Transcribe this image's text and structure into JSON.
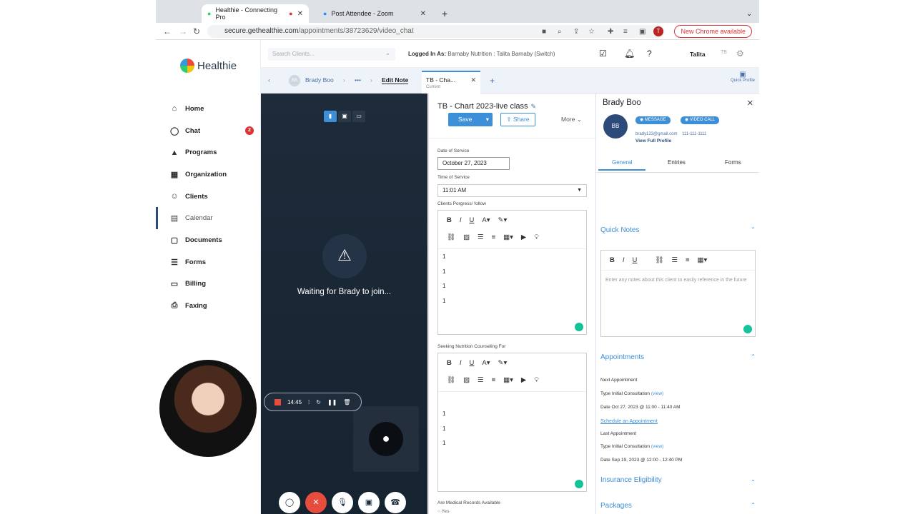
{
  "browser": {
    "tabs": [
      {
        "label": "Healthie - Connecting Pro"
      },
      {
        "label": "Post Attendee - Zoom"
      }
    ],
    "url_domain": "secure.gethealthie.com",
    "url_path": "/appointments/38723629/video_chat",
    "new_chrome_label": "New Chrome available",
    "profile_initial": "T"
  },
  "app": {
    "logo_text": "Healthie",
    "search_placeholder": "Search Clients...",
    "logged_in_label": "Logged In As:",
    "logged_in_value": "Barnaby Nutrition : Talita Barnaby (Switch)",
    "user_name": "Talita",
    "user_initials": "TB"
  },
  "sidebar": {
    "items": [
      {
        "label": "Home",
        "icon": "home-icon"
      },
      {
        "label": "Chat",
        "icon": "chat-icon",
        "badge": "2"
      },
      {
        "label": "Programs",
        "icon": "programs-icon"
      },
      {
        "label": "Organization",
        "icon": "organization-icon"
      },
      {
        "label": "Clients",
        "icon": "clients-icon"
      },
      {
        "label": "Calendar",
        "icon": "calendar-icon"
      },
      {
        "label": "Documents",
        "icon": "documents-icon"
      },
      {
        "label": "Forms",
        "icon": "forms-icon"
      },
      {
        "label": "Billing",
        "icon": "billing-icon"
      },
      {
        "label": "Faxing",
        "icon": "faxing-icon"
      }
    ]
  },
  "subbar": {
    "client_initials": "BB",
    "client_name": "Brady Boo",
    "dots": "•••",
    "edit_note": "Edit Note",
    "note_tab_title": "TB - Cha...",
    "note_tab_sub": "Current",
    "quick_profile": "Quick Profile"
  },
  "video": {
    "waiting": "Waiting for Brady to join...",
    "timer": "14:45"
  },
  "note": {
    "title": "TB - Chart 2023-live class",
    "save": "Save",
    "share": "Share",
    "more": "More",
    "date_label": "Date of Service",
    "date_value": "October 27, 2023",
    "time_label": "Time of Service",
    "time_value": "11:01 AM",
    "progress_label": "Clients Porgress/ follow",
    "progress_lines": [
      "1",
      "1",
      "1",
      "1"
    ],
    "seeking_label": "Seeking Nutrition Counseling For",
    "seeking_lines": [
      "1",
      "1",
      "1"
    ],
    "medical_label": "Are Medical Records Available",
    "medical_option": "Yes"
  },
  "profile": {
    "name": "Brady Boo",
    "initials": "BB",
    "message": "MESSAGE",
    "video_call": "VIDEO CALL",
    "email": "brady123@gmail.com",
    "phone": "111-111-1111",
    "view_full": "View Full Profile",
    "tabs": [
      "General",
      "Entries",
      "Forms"
    ],
    "quick_notes": "Quick Notes",
    "quick_placeholder": "Enter any notes about this client to easily reference in the future",
    "appointments": "Appointments",
    "next_appt": "Next Appointment",
    "next_type_label": "Type",
    "next_type": "Initial Consultation",
    "view": "(view)",
    "next_date_label": "Date",
    "next_date": "Oct 27, 2023 @ 11:00 - 11:40 AM",
    "schedule": "Schedule an Appointment",
    "last_appt": "Last Appointment",
    "last_type": "Initial Consultation",
    "last_date": "Sep 19, 2023 @ 12:00 - 12:40 PM",
    "insurance": "Insurance Eligibility",
    "packages": "Packages"
  }
}
